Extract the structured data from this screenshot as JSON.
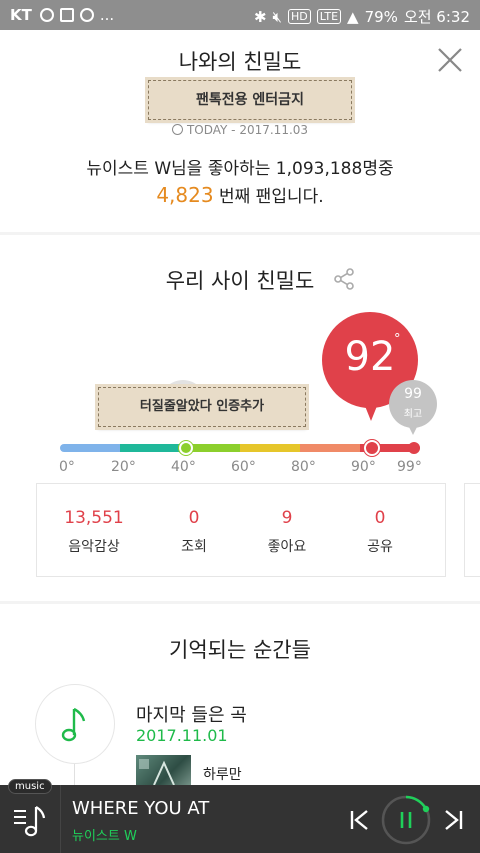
{
  "status_bar": {
    "carrier": "KT",
    "more": "...",
    "network": "LTE",
    "battery": "79%",
    "time": "오전 6:32"
  },
  "header": {
    "title": "나와의 친밀도",
    "close_icon": "close-icon"
  },
  "fan_card": {
    "ribbon": "팬톡전용 엔터금지",
    "today": "TODAY - 2017.11.03",
    "rank_line1": "뉴이스트 W님을 좋아하는 1,093,188명중",
    "rank_number": "4,823",
    "rank_suffix": " 번째 팬입니다."
  },
  "intimacy": {
    "title": "우리 사이 친밀도",
    "score": "92",
    "degree_symbol": "°",
    "max_value": "99",
    "max_label": "최고",
    "badge": "터질줄알았다 인증추가",
    "score_value": 92,
    "max_score": 99,
    "ticks": [
      "0°",
      "20°",
      "40°",
      "60°",
      "80°",
      "90°",
      "99°"
    ],
    "scale_colors": [
      "#7fb3ea",
      "#1fb89a",
      "#8ccf2c",
      "#e6c62a",
      "#f08a67",
      "#e0414a"
    ],
    "accent_color": "#e0414a"
  },
  "stats": [
    {
      "value": "13,551",
      "label": "음악감상"
    },
    {
      "value": "0",
      "label": "조회"
    },
    {
      "value": "9",
      "label": "좋아요"
    },
    {
      "value": "0",
      "label": "공유"
    }
  ],
  "moments": {
    "title": "기억되는 순간들",
    "item": {
      "title": "마지막 들은 곡",
      "date": "2017.11.01",
      "song": "하루만"
    }
  },
  "player": {
    "tag": "music",
    "song": "WHERE YOU AT",
    "artist": "뉴이스트 W",
    "accent_color": "#1fd05a"
  }
}
